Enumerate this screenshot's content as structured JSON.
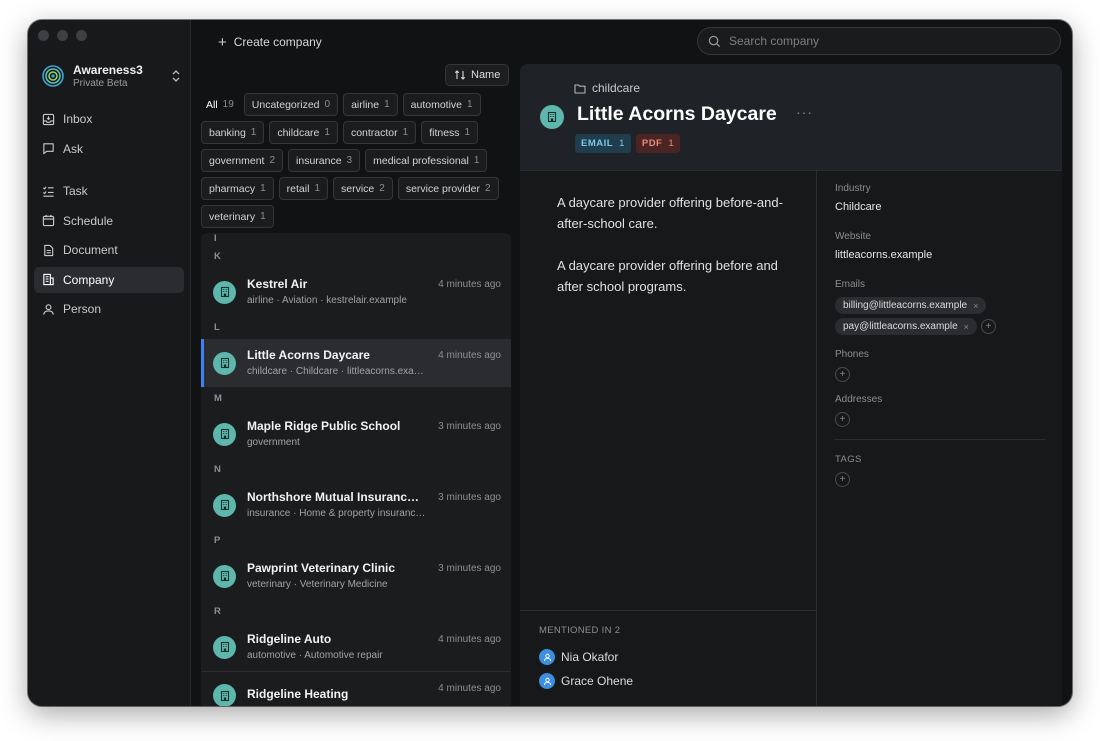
{
  "workspace": {
    "name": "Awareness3",
    "subtitle": "Private Beta"
  },
  "nav": [
    {
      "label": "Inbox",
      "icon": "inbox-icon"
    },
    {
      "label": "Ask",
      "icon": "chat-icon"
    },
    {
      "label": "Task",
      "icon": "task-icon"
    },
    {
      "label": "Schedule",
      "icon": "calendar-icon"
    },
    {
      "label": "Document",
      "icon": "document-icon"
    },
    {
      "label": "Company",
      "icon": "building-icon",
      "active": true
    },
    {
      "label": "Person",
      "icon": "person-icon"
    }
  ],
  "toolbar": {
    "create_label": "Create company",
    "search_placeholder": "Search company",
    "sort_label": "Name"
  },
  "filters": [
    {
      "label": "All",
      "count": "19"
    },
    {
      "label": "Uncategorized",
      "count": "0"
    },
    {
      "label": "airline",
      "count": "1"
    },
    {
      "label": "automotive",
      "count": "1"
    },
    {
      "label": "banking",
      "count": "1"
    },
    {
      "label": "childcare",
      "count": "1"
    },
    {
      "label": "contractor",
      "count": "1"
    },
    {
      "label": "fitness",
      "count": "1"
    },
    {
      "label": "government",
      "count": "2"
    },
    {
      "label": "insurance",
      "count": "3"
    },
    {
      "label": "medical professional",
      "count": "1"
    },
    {
      "label": "pharmacy",
      "count": "1"
    },
    {
      "label": "retail",
      "count": "1"
    },
    {
      "label": "service",
      "count": "2"
    },
    {
      "label": "service provider",
      "count": "2"
    },
    {
      "label": "veterinary",
      "count": "1"
    }
  ],
  "list": {
    "letters": [
      "I",
      "K",
      "L",
      "M",
      "N",
      "P",
      "R"
    ],
    "rows": [
      {
        "title": "Kestrel Air",
        "subtitle": "airline · Aviation · kestrelair.example",
        "time": "4 minutes ago"
      },
      {
        "title": "Little Acorns Daycare",
        "subtitle": "childcare · Childcare · littleacorns.exam...",
        "time": "4 minutes ago"
      },
      {
        "title": "Maple Ridge Public School",
        "subtitle": "government",
        "time": "3 minutes ago"
      },
      {
        "title": "Northshore Mutual Insurance C...",
        "subtitle": "insurance · Home & property insurance ...",
        "time": "3 minutes ago"
      },
      {
        "title": "Pawprint Veterinary Clinic",
        "subtitle": "veterinary · Veterinary Medicine",
        "time": "3 minutes ago"
      },
      {
        "title": "Ridgeline Auto",
        "subtitle": "automotive · Automotive repair",
        "time": "4 minutes ago"
      },
      {
        "title": "Ridgeline Heating",
        "subtitle": "",
        "time": "4 minutes ago"
      }
    ]
  },
  "detail": {
    "category": "childcare",
    "title": "Little Acorns Daycare",
    "more": "···",
    "badges": [
      {
        "label": "EMAIL",
        "count": "1"
      },
      {
        "label": "PDF",
        "count": "1"
      }
    ],
    "descriptions": [
      "A daycare provider offering before-and-after-school care.",
      "A daycare provider offering before and after school programs."
    ],
    "industry_label": "Industry",
    "industry": "Childcare",
    "website_label": "Website",
    "website": "littleacorns.example",
    "emails_label": "Emails",
    "emails": [
      "billing@littleacorns.example",
      "pay@littleacorns.example"
    ],
    "phones_label": "Phones",
    "addresses_label": "Addresses",
    "tags_label": "TAGS",
    "mentions_label": "MENTIONED IN",
    "mentions_count": "2",
    "mentions": [
      "Nia Okafor",
      "Grace Ohene"
    ]
  },
  "colors": {
    "accent": "#3b82f6",
    "avatar": "#5eb7ad",
    "email_badge": "#7cc7e4",
    "pdf_badge": "#e98b7e"
  }
}
